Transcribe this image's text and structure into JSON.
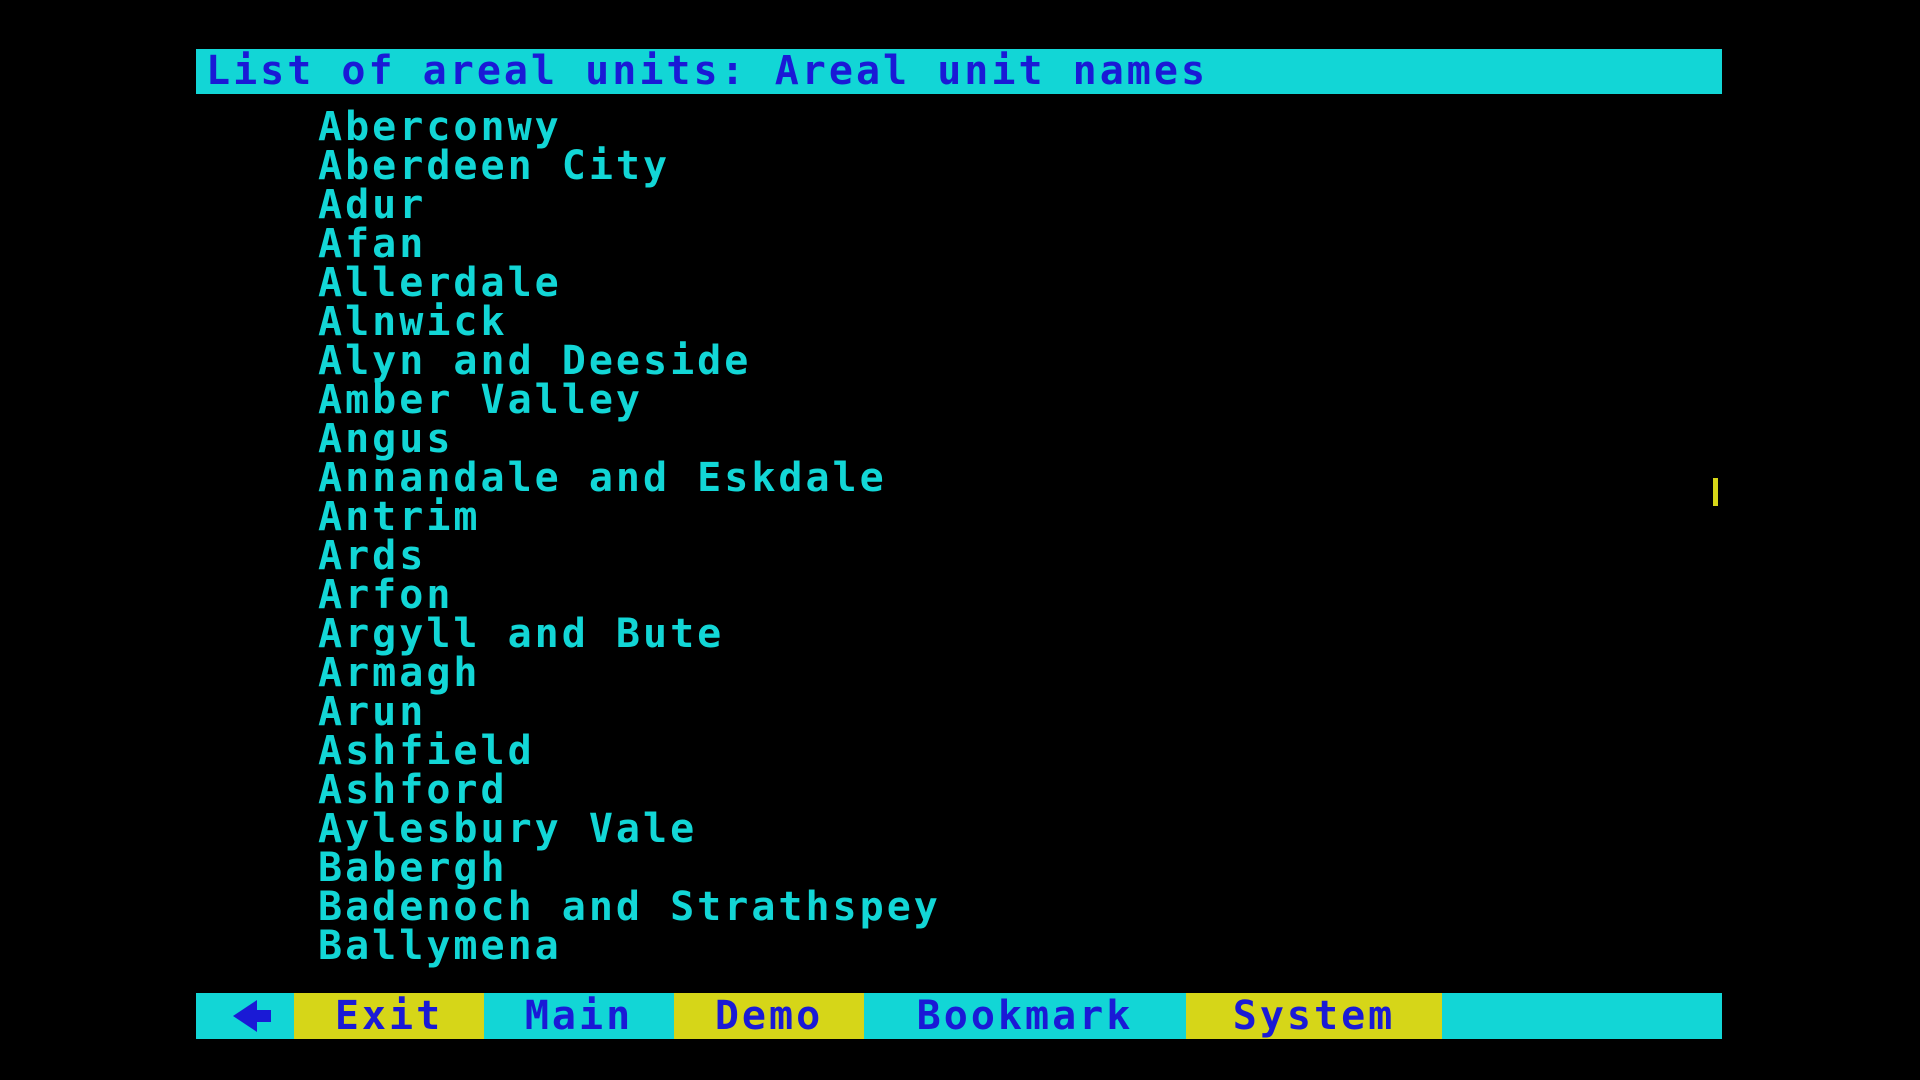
{
  "header": {
    "title": "List of areal units: Areal unit names"
  },
  "list": {
    "items": [
      "Aberconwy",
      "Aberdeen City",
      "Adur",
      "Afan",
      "Allerdale",
      "Alnwick",
      "Alyn and Deeside",
      "Amber Valley",
      "Angus",
      "Annandale and Eskdale",
      "Antrim",
      "Ards",
      "Arfon",
      "Argyll and Bute",
      "Armagh",
      "Arun",
      "Ashfield",
      "Ashford",
      "Aylesbury Vale",
      "Babergh",
      "Badenoch and Strathspey",
      "Ballymena"
    ]
  },
  "menu": {
    "back_icon": "left-arrow-icon",
    "exit": "Exit",
    "main": "Main",
    "demo": "Demo",
    "bookmark": "Bookmark",
    "system": "System"
  },
  "colors": {
    "background": "#000000",
    "cyan": "#12d6d6",
    "blue": "#1a1ad6",
    "yellow": "#d6d618"
  }
}
